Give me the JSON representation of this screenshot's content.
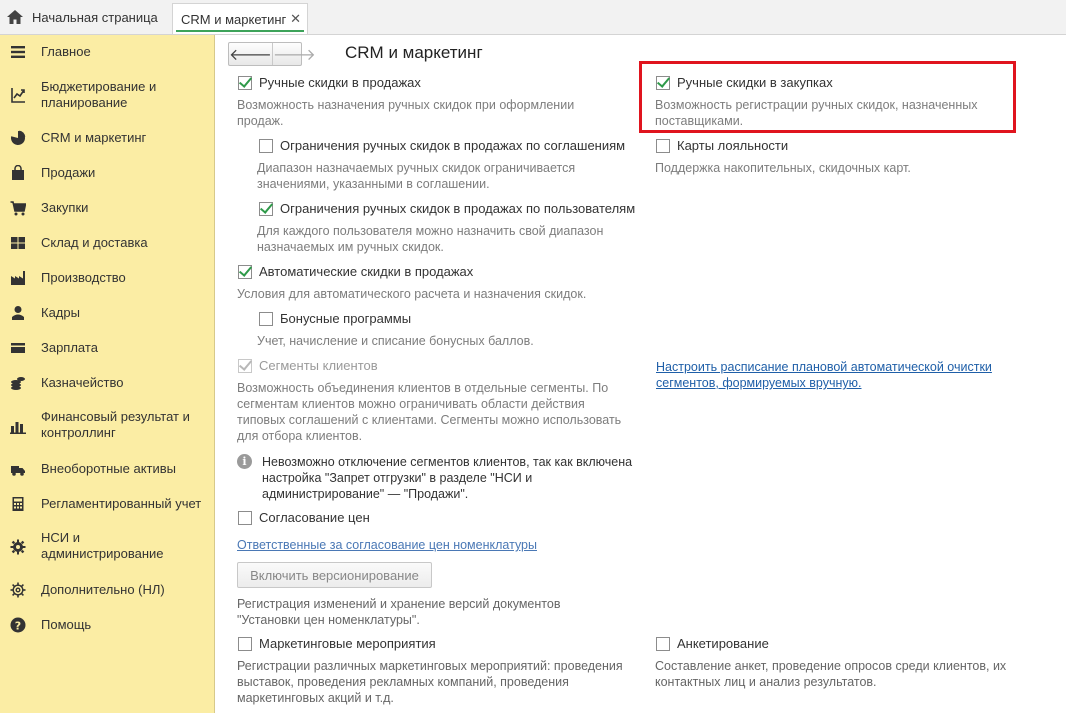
{
  "tabs": {
    "home_label": "Начальная страница",
    "active_label": "CRM и маркетинг",
    "close_glyph": "✕"
  },
  "sidebar": {
    "items": [
      {
        "label": "Главное",
        "icon": "menu-lines-icon"
      },
      {
        "label": "Бюджетирование и планирование",
        "icon": "budget-icon"
      },
      {
        "label": "CRM и маркетинг",
        "icon": "pie-chart-icon"
      },
      {
        "label": "Продажи",
        "icon": "shopping-bag-icon"
      },
      {
        "label": "Закупки",
        "icon": "cart-icon"
      },
      {
        "label": "Склад и доставка",
        "icon": "warehouse-icon"
      },
      {
        "label": "Производство",
        "icon": "factory-icon"
      },
      {
        "label": "Кадры",
        "icon": "person-icon"
      },
      {
        "label": "Зарплата",
        "icon": "wallet-icon"
      },
      {
        "label": "Казначейство",
        "icon": "coins-icon"
      },
      {
        "label": "Финансовый результат и контроллинг",
        "icon": "bar-chart-icon"
      },
      {
        "label": "Внеоборотные активы",
        "icon": "truck-icon"
      },
      {
        "label": "Регламентированный учет",
        "icon": "calculator-icon"
      },
      {
        "label": "НСИ и администрирование",
        "icon": "gear-icon"
      },
      {
        "label": "Дополнительно (НЛ)",
        "icon": "gear-outline-icon"
      },
      {
        "label": "Помощь",
        "icon": "help-icon"
      }
    ]
  },
  "main": {
    "title": "CRM и маркетинг",
    "nav_back": "🡐",
    "nav_forward": "🡒",
    "left": {
      "manual_sales": {
        "label": "Ручные скидки в продажах",
        "checked": true,
        "desc": "Возможность назначения ручных скидок при оформлении продаж."
      },
      "limit_by_agreements": {
        "label": "Ограничения ручных скидок в продажах по соглашениям",
        "checked": false,
        "desc": "Диапазон назначаемых ручных скидок ограничивается значениями, указанными в соглашении."
      },
      "limit_by_users": {
        "label": "Ограничения ручных скидок в продажах по пользователям",
        "checked": true,
        "desc": "Для каждого пользователя можно назначить свой диапазон назначаемых им ручных скидок."
      },
      "auto_discounts": {
        "label": "Автоматические скидки в продажах",
        "checked": true,
        "desc": "Условия для автоматического расчета и назначения скидок."
      },
      "bonus_programs": {
        "label": "Бонусные программы",
        "checked": false,
        "desc": "Учет, начисление и списание бонусных баллов."
      },
      "client_segments": {
        "label": "Сегменты клиентов",
        "checked": true,
        "disabled": true,
        "desc": "Возможность объединения клиентов в отдельные сегменты. По сегментам клиентов можно ограничивать области действия типовых соглашений с клиентами. Сегменты можно использовать для отбора клиентов."
      },
      "segments_info": "Невозможно отключение сегментов клиентов, так как включена настройка \"Запрет отгрузки\" в разделе \"НСИ и администрирование\" — \"Продажи\".",
      "price_approval": {
        "label": "Согласование цен",
        "checked": false
      },
      "price_approval_link": "Ответственные за согласование цен номенклатуры",
      "versioning_button": "Включить версионирование",
      "versioning_desc": "Регистрация изменений и хранение версий документов \"Установки цен номенклатуры\".",
      "marketing_events": {
        "label": "Маркетинговые мероприятия",
        "checked": false,
        "desc": "Регистрации различных маркетинговых мероприятий: проведения выставок, проведения рекламных компаний, проведения маркетинговых акций и т.д."
      }
    },
    "right": {
      "manual_purchases": {
        "label": "Ручные скидки в закупках",
        "checked": true,
        "desc": "Возможность регистрации ручных скидок, назначенных поставщиками."
      },
      "loyalty_cards": {
        "label": "Карты лояльности",
        "checked": false,
        "desc": "Поддержка накопительных, скидочных карт."
      },
      "schedule_link": "Настроить расписание плановой автоматической очистки сегментов, формируемых вручную.",
      "surveys": {
        "label": "Анкетирование",
        "checked": false,
        "desc": "Составление анкет, проведение опросов среди клиентов, их контактных лиц и анализ результатов."
      }
    }
  },
  "colors": {
    "sidebar_bg": "#fbeda4",
    "check_green": "#2f9a4a",
    "highlight_red": "#e0141e",
    "link_blue": "#1f5fa8"
  }
}
